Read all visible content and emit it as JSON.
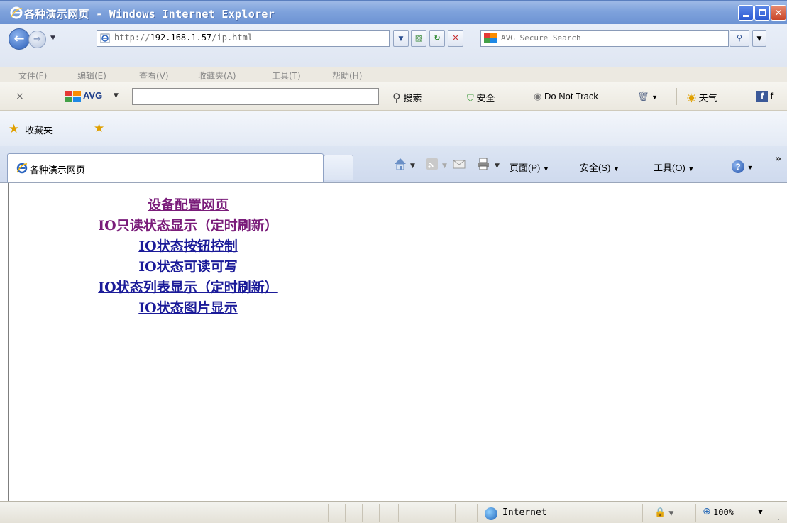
{
  "window": {
    "title": "各种演示网页 - Windows Internet Explorer"
  },
  "address": {
    "url_prefix": "http://",
    "url_host": "192.168.1.57",
    "url_path": "/ip.html",
    "search_placeholder": "AVG Secure Search"
  },
  "menu": [
    "文件(F)",
    "编辑(E)",
    "查看(V)",
    "收藏夹(A)",
    "工具(T)",
    "帮助(H)"
  ],
  "avg_toolbar": {
    "close": "×",
    "brand": "AVG",
    "search_label": "搜索",
    "safety_label": "安全",
    "dnt_label": "Do Not Track",
    "weather_label": "天气",
    "fb_label": "f"
  },
  "favorites": {
    "label": "收藏夹"
  },
  "tab": {
    "title": "各种演示网页"
  },
  "commands": {
    "page": "页面(P)",
    "safety": "安全(S)",
    "tools": "工具(O)",
    "more": "»"
  },
  "links": [
    {
      "text": "设备配置网页",
      "visited": true
    },
    {
      "text": "IO只读状态显示（定时刷新）",
      "visited": true
    },
    {
      "text": "IO状态按钮控制",
      "visited": false
    },
    {
      "text": "IO状态可读可写",
      "visited": false
    },
    {
      "text": "IO状态列表显示（定时刷新）",
      "visited": false
    },
    {
      "text": "IO状态图片显示",
      "visited": false
    }
  ],
  "status": {
    "zone": "Internet",
    "zoom": "100%"
  },
  "colors": {
    "link": "#1b1b99",
    "link_visited": "#7a1c7a"
  }
}
